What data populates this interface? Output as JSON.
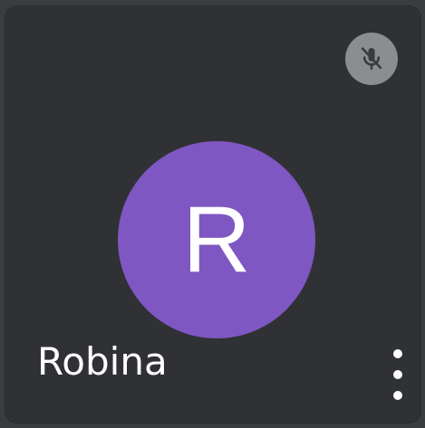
{
  "participant": {
    "name": "Robina",
    "avatar_letter": "R",
    "avatar_color": "#7e57c2",
    "mic_status": "muted",
    "mute_icon": "mic-off-icon",
    "menu_icon": "more-vert-icon"
  },
  "colors": {
    "tile_background": "#303134",
    "mute_badge": "#8c8d90",
    "text": "#ffffff"
  }
}
